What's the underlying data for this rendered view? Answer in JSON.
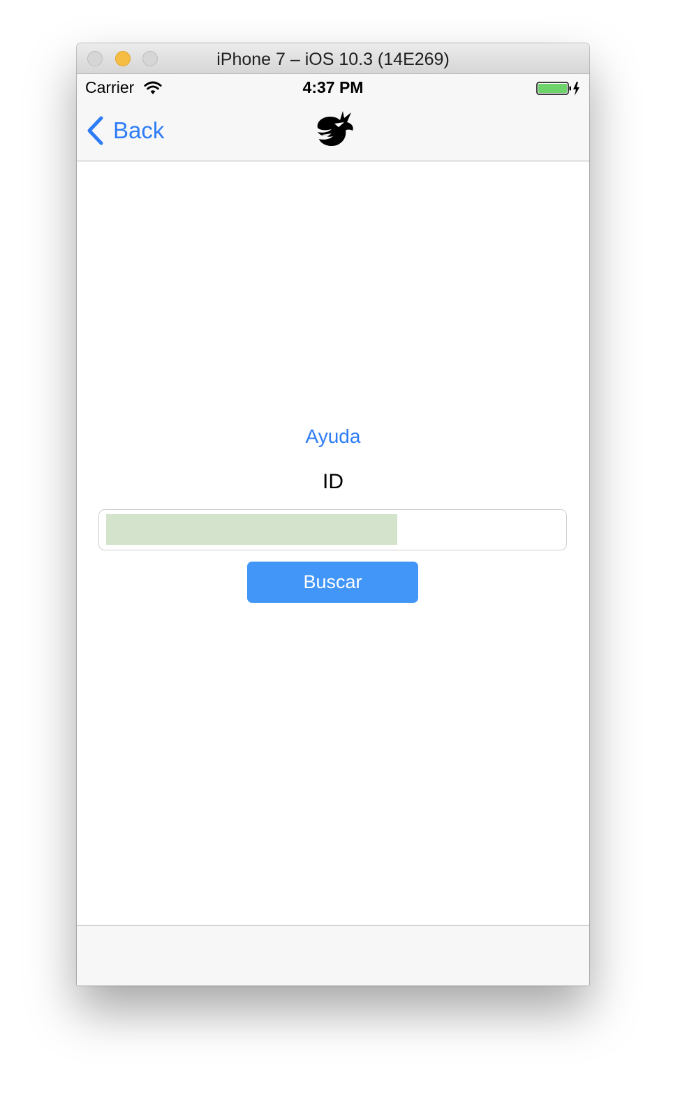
{
  "window": {
    "title": "iPhone 7 – iOS 10.3 (14E269)"
  },
  "status_bar": {
    "carrier": "Carrier",
    "time": "4:37 PM",
    "battery_color": "#6fd36b",
    "battery_level": 1.0
  },
  "nav_bar": {
    "back_label": "Back",
    "logo_icon": "bird-logo-icon"
  },
  "main": {
    "help_link": "Ayuda",
    "id_label": "ID",
    "id_field_value": "",
    "search_button": "Buscar"
  },
  "colors": {
    "accent": "#2e7cf6",
    "button": "#4296f7",
    "field_highlight": "#d4e3cc"
  }
}
